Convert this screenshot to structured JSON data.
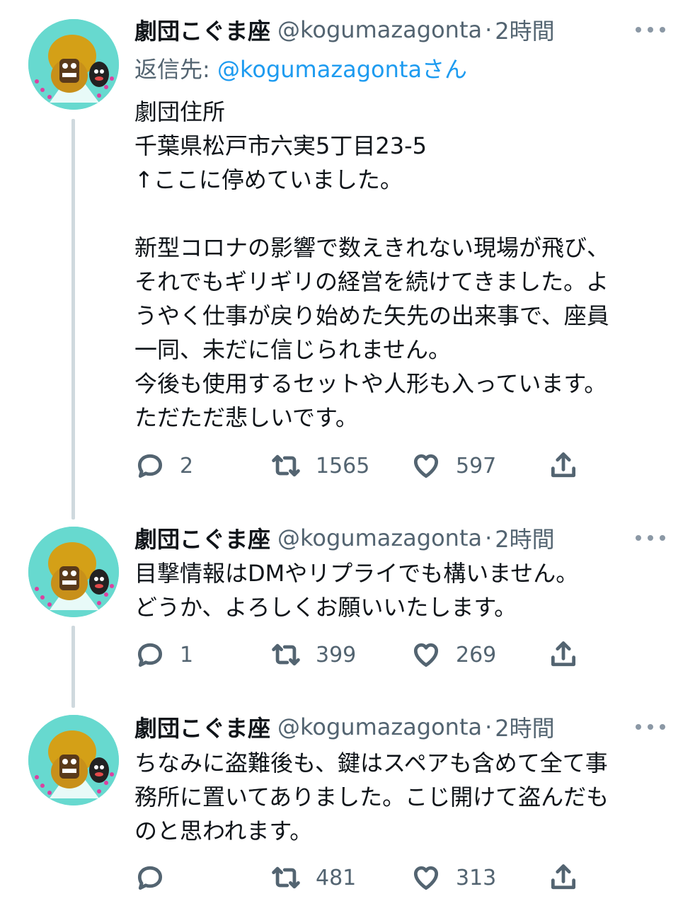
{
  "tweets": [
    {
      "name": "劇団こぐま座",
      "handle": "@kogumazagonta",
      "dot": "·",
      "time": "2時間",
      "reply_prefix": "返信先: ",
      "reply_mention": "@kogumazagontaさん",
      "lines": [
        "劇団住所",
        "千葉県松戸市六実5丁目23-5",
        "↑ここに停めていました。",
        "",
        "新型コロナの影響で数えきれない現場が飛び、",
        "それでもギリギリの経営を続けてきました。よ",
        "うやく仕事が戻り始めた矢先の出来事で、座員",
        "一同、未だに信じられません。",
        "今後も使用するセットや人形も入っています。",
        "ただただ悲しいです。"
      ],
      "reply_count": "2",
      "retweet_count": "1565",
      "like_count": "597"
    },
    {
      "name": "劇団こぐま座",
      "handle": "@kogumazagonta",
      "dot": "·",
      "time": "2時間",
      "lines": [
        "目撃情報はDMやリプライでも構いません。",
        "どうか、よろしくお願いいたします。"
      ],
      "reply_count": "1",
      "retweet_count": "399",
      "like_count": "269"
    },
    {
      "name": "劇団こぐま座",
      "handle": "@kogumazagonta",
      "dot": "·",
      "time": "2時間",
      "lines": [
        "ちなみに盗難後も、鍵はスペアも含めて全て事",
        "務所に置いてありました。こじ開けて盗んだも",
        "のと思われます。"
      ],
      "reply_count": "",
      "retweet_count": "481",
      "like_count": "313"
    }
  ],
  "icons": {
    "reply": "speech-bubble-icon",
    "retweet": "retweet-arrows-icon",
    "like": "heart-icon",
    "share": "share-upload-icon",
    "more": "more-dots-icon"
  },
  "colors": {
    "text": "#0f1419",
    "secondary": "#536471",
    "link": "#1d9bf0",
    "thread_line": "#cfd9de",
    "avatar_bg": "#67d9cf"
  }
}
